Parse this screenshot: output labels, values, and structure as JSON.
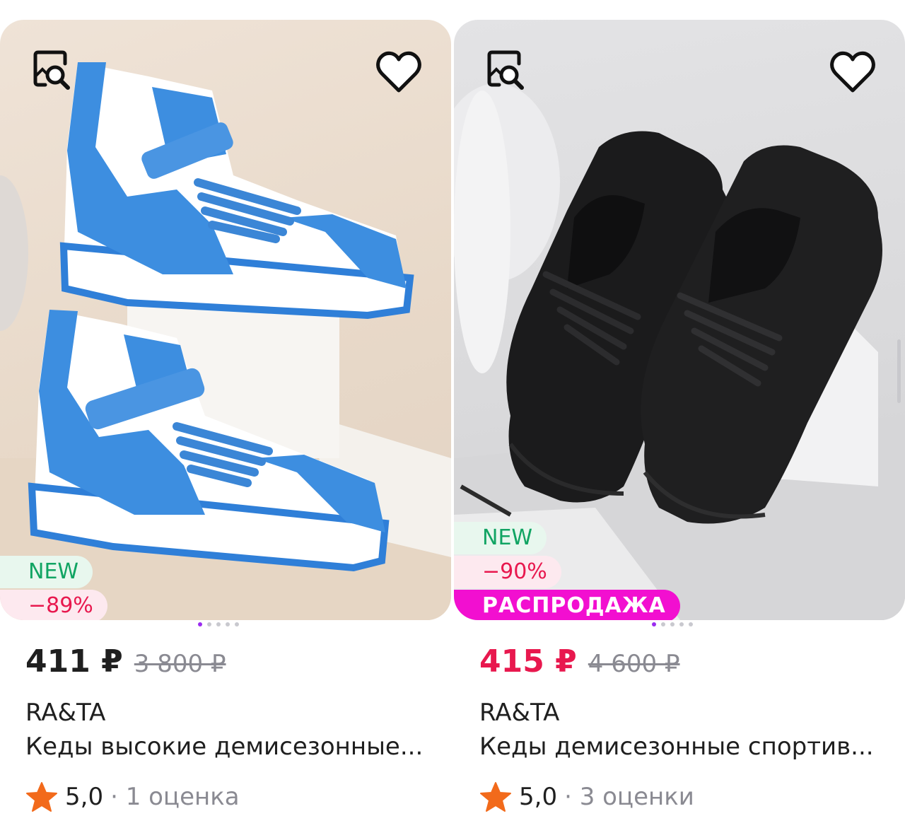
{
  "products": [
    {
      "image_alt": "Кеды высокие демисезонные",
      "search_icon": "image-search-icon",
      "favorite_icon": "heart-outline-icon",
      "badges": [
        {
          "type": "new",
          "label": "NEW"
        },
        {
          "type": "discount",
          "label": "−89%"
        }
      ],
      "carousel": {
        "count": 5,
        "active": 0
      },
      "price": "411 ₽",
      "price_is_sale": false,
      "old_price": "3 800 ₽",
      "brand": "RA&TA",
      "title": "Кеды высокие демисезонные...",
      "rating": "5,0",
      "reviews": "· 1 оценка"
    },
    {
      "image_alt": "Кеды демисезонные спортивные",
      "search_icon": "image-search-icon",
      "favorite_icon": "heart-outline-icon",
      "badges": [
        {
          "type": "new",
          "label": "NEW"
        },
        {
          "type": "discount",
          "label": "−90%"
        },
        {
          "type": "sale",
          "label": "РАСПРОДАЖА"
        }
      ],
      "carousel": {
        "count": 5,
        "active": 0
      },
      "price": "415 ₽",
      "price_is_sale": true,
      "old_price": "4 600 ₽",
      "brand": "RA&TA",
      "title": "Кеды демисезонные спортив...",
      "rating": "5,0",
      "reviews": "· 3 оценки"
    }
  ],
  "colors": {
    "sale_price": "#e8184e",
    "new_badge_text": "#11a463",
    "sale_badge_bg": "#f20fd0",
    "star": "#f26a1b",
    "carousel_active": "#9b2cf0"
  }
}
